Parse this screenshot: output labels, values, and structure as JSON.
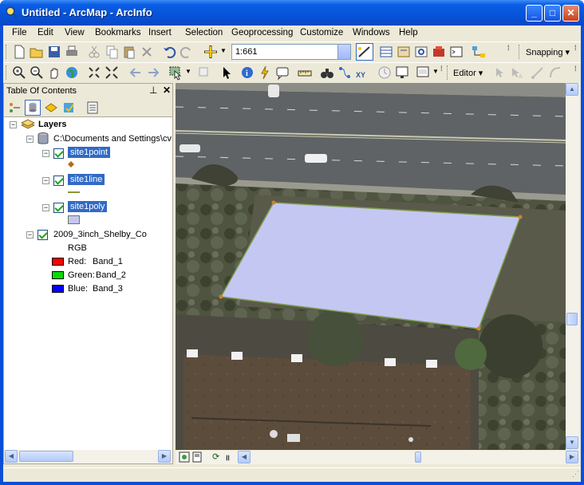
{
  "window": {
    "title": "Untitled - ArcMap - ArcInfo"
  },
  "menu": [
    "File",
    "Edit",
    "View",
    "Bookmarks",
    "Insert",
    "Selection",
    "Geoprocessing",
    "Customize",
    "Windows",
    "Help"
  ],
  "toolbar": {
    "scale_value": "1:661",
    "snapping_label": "Snapping ▾",
    "editor_label": "Editor ▾"
  },
  "toc": {
    "title": "Table Of Contents",
    "layers_label": "Layers",
    "workspace_label": "C:\\Documents and Settings\\cv",
    "layers": [
      {
        "name": "site1point",
        "symbol": "point"
      },
      {
        "name": "site1line",
        "symbol": "line"
      },
      {
        "name": "site1poly",
        "symbol": "poly"
      }
    ],
    "raster": {
      "name": "2009_3inch_Shelby_Co",
      "type": "RGB",
      "bands": [
        {
          "label": "Red:",
          "band": "Band_1",
          "color": "#ff0000"
        },
        {
          "label": "Green:",
          "band": "Band_2",
          "color": "#00e000"
        },
        {
          "label": "Blue:",
          "band": "Band_3",
          "color": "#0000ff"
        }
      ]
    }
  },
  "colors": {
    "polygon_fill": "#c5c7f3",
    "polygon_outline": "#7ea04f",
    "vertex": "#d0822a",
    "selection": "#316ac5"
  }
}
